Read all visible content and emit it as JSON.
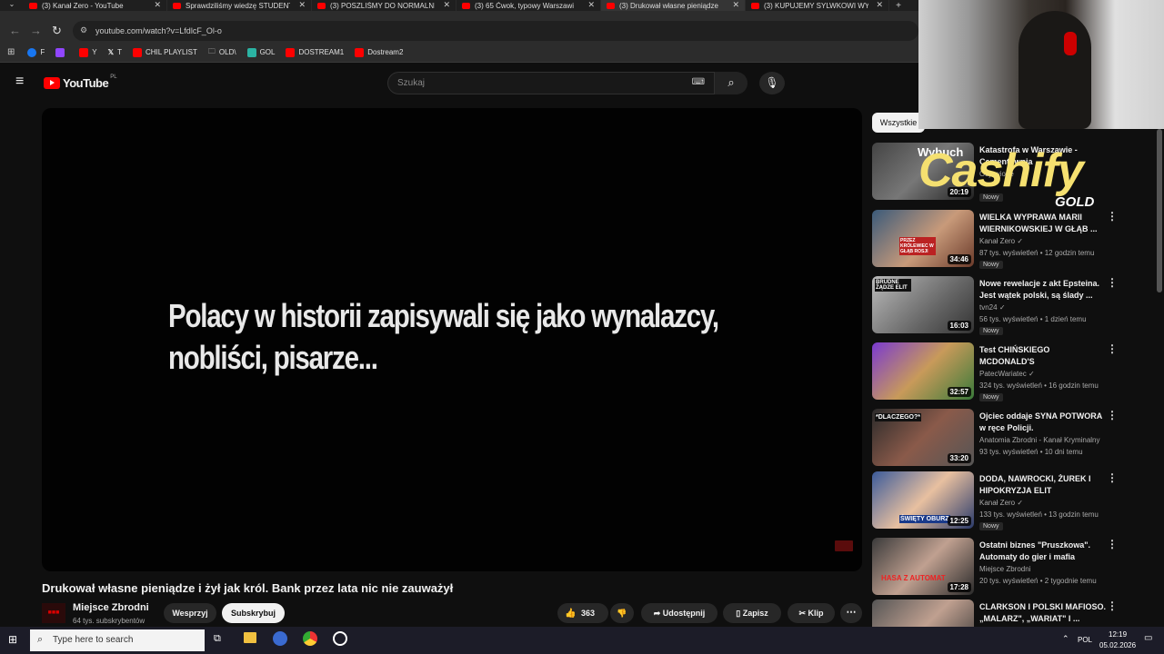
{
  "browser": {
    "tabs": [
      {
        "label": "(3) Kanał Zero - YouTube",
        "active": false
      },
      {
        "label": "Sprawdziliśmy wiedzę STUDENT",
        "active": false
      },
      {
        "label": "(3) POSZLIŚMY DO NORMALNI",
        "active": false
      },
      {
        "label": "(3) 65 Ćwok, typowy Warszawi",
        "active": false
      },
      {
        "label": "(3) Drukował własne pieniądze",
        "active": true
      },
      {
        "label": "(3) KUPUJEMY SYLWKOWI WYP",
        "active": false
      }
    ],
    "url": "youtube.com/watch?v=LfdlcF_Ol-o",
    "bookmarks": [
      {
        "label": "F",
        "color": "#1877f2"
      },
      {
        "label": "",
        "color": "#9146ff"
      },
      {
        "label": "Y",
        "color": "#ff0000"
      },
      {
        "label": "T",
        "color": "#ffffff"
      },
      {
        "label": "CHIL PLAYLIST",
        "color": "#ff0000"
      },
      {
        "label": "OLD\\",
        "color": "#cccccc"
      },
      {
        "label": "GOL",
        "color": "#2bb3a3"
      },
      {
        "label": "DOSTREAM1",
        "color": "#ff0000"
      },
      {
        "label": "Dostream2",
        "color": "#ff0000"
      }
    ]
  },
  "youtube": {
    "logo": "YouTube",
    "logo_region": "PL",
    "search_placeholder": "Szukaj",
    "filter_chip": "Wszystkie"
  },
  "player": {
    "caption_line1": "Polacy w historii zapisywali się jako wynalazcy,",
    "caption_line2": "nobliści, pisarze..."
  },
  "video": {
    "title": "Drukował własne pieniądze i żył jak król. Bank przez lata nic nie zauważył",
    "channel": "Miejsce Zbrodni",
    "subscribers": "64 tys. subskrybentów",
    "join_label": "Wesprzyj",
    "subscribe_label": "Subskrybuj",
    "likes": "363",
    "share_label": "Udostępnij",
    "save_label": "Zapisz",
    "clip_label": "Klip"
  },
  "recommendations": [
    {
      "title": "Katastrofa w Warszawie - Cementownia",
      "channel": "Objawione",
      "meta": "",
      "duration": "20:19",
      "new": "Nowy",
      "thumb_text": "Wybuch"
    },
    {
      "title": "WIELKA WYPRAWA MARII WIERNIKOWSKIEJ W GŁĄB ...",
      "channel": "Kanał Zero",
      "meta": "87 tys. wyświetleń • 12 godzin temu",
      "duration": "34:46",
      "new": "Nowy",
      "thumb_text": "PRZEZ KRÓLEWIEC W GŁĄB ROSJI"
    },
    {
      "title": "Nowe rewelacje z akt Epsteina. Jest wątek polski, są ślady ...",
      "channel": "tvn24",
      "meta": "56 tys. wyświetleń • 1 dzień temu",
      "duration": "16:03",
      "new": "Nowy",
      "thumb_text": "BRUDNE ŻĄDZE ELIT"
    },
    {
      "title": "Test CHIŃSKIEGO MCDONALD'S",
      "channel": "PatecWariatec",
      "meta": "324 tys. wyświetleń • 16 godzin temu",
      "duration": "32:57",
      "new": "Nowy",
      "thumb_text": ""
    },
    {
      "title": "Ojciec oddaje SYNA POTWORA w ręce Policji.",
      "channel": "Anatomia Zbrodni - Kanał Kryminalny",
      "meta": "93 tys. wyświetleń • 10 dni temu",
      "duration": "33:20",
      "new": "",
      "thumb_text": "*DLACZEGO?*"
    },
    {
      "title": "DODA, NAWROCKI, ŻUREK I HIPOKRYZJA ELIT",
      "channel": "Kanał Zero",
      "meta": "133 tys. wyświetleń • 13 godzin temu",
      "duration": "12:25",
      "new": "Nowy",
      "thumb_text": "ŚWIĘTY OBURZ"
    },
    {
      "title": "Ostatni biznes \"Pruszkowa\". Automaty do gier i mafia",
      "channel": "Miejsce Zbrodni",
      "meta": "20 tys. wyświetleń • 2 tygodnie temu",
      "duration": "17:28",
      "new": "",
      "thumb_text": "HASA Z AUTOMAT"
    },
    {
      "title": "CLARKSON I POLSKI MAFIOSO. „MALARZ\", „WARIAT\" I ...",
      "channel": "",
      "meta": "",
      "duration": "",
      "new": "",
      "thumb_text": ""
    }
  ],
  "overlay": {
    "brand": "Cashify",
    "brand_sub": "GOLD"
  },
  "taskbar": {
    "search_placeholder": "Type here to search",
    "lang": "POL",
    "time": "12:19",
    "date": "05.02.2026"
  }
}
